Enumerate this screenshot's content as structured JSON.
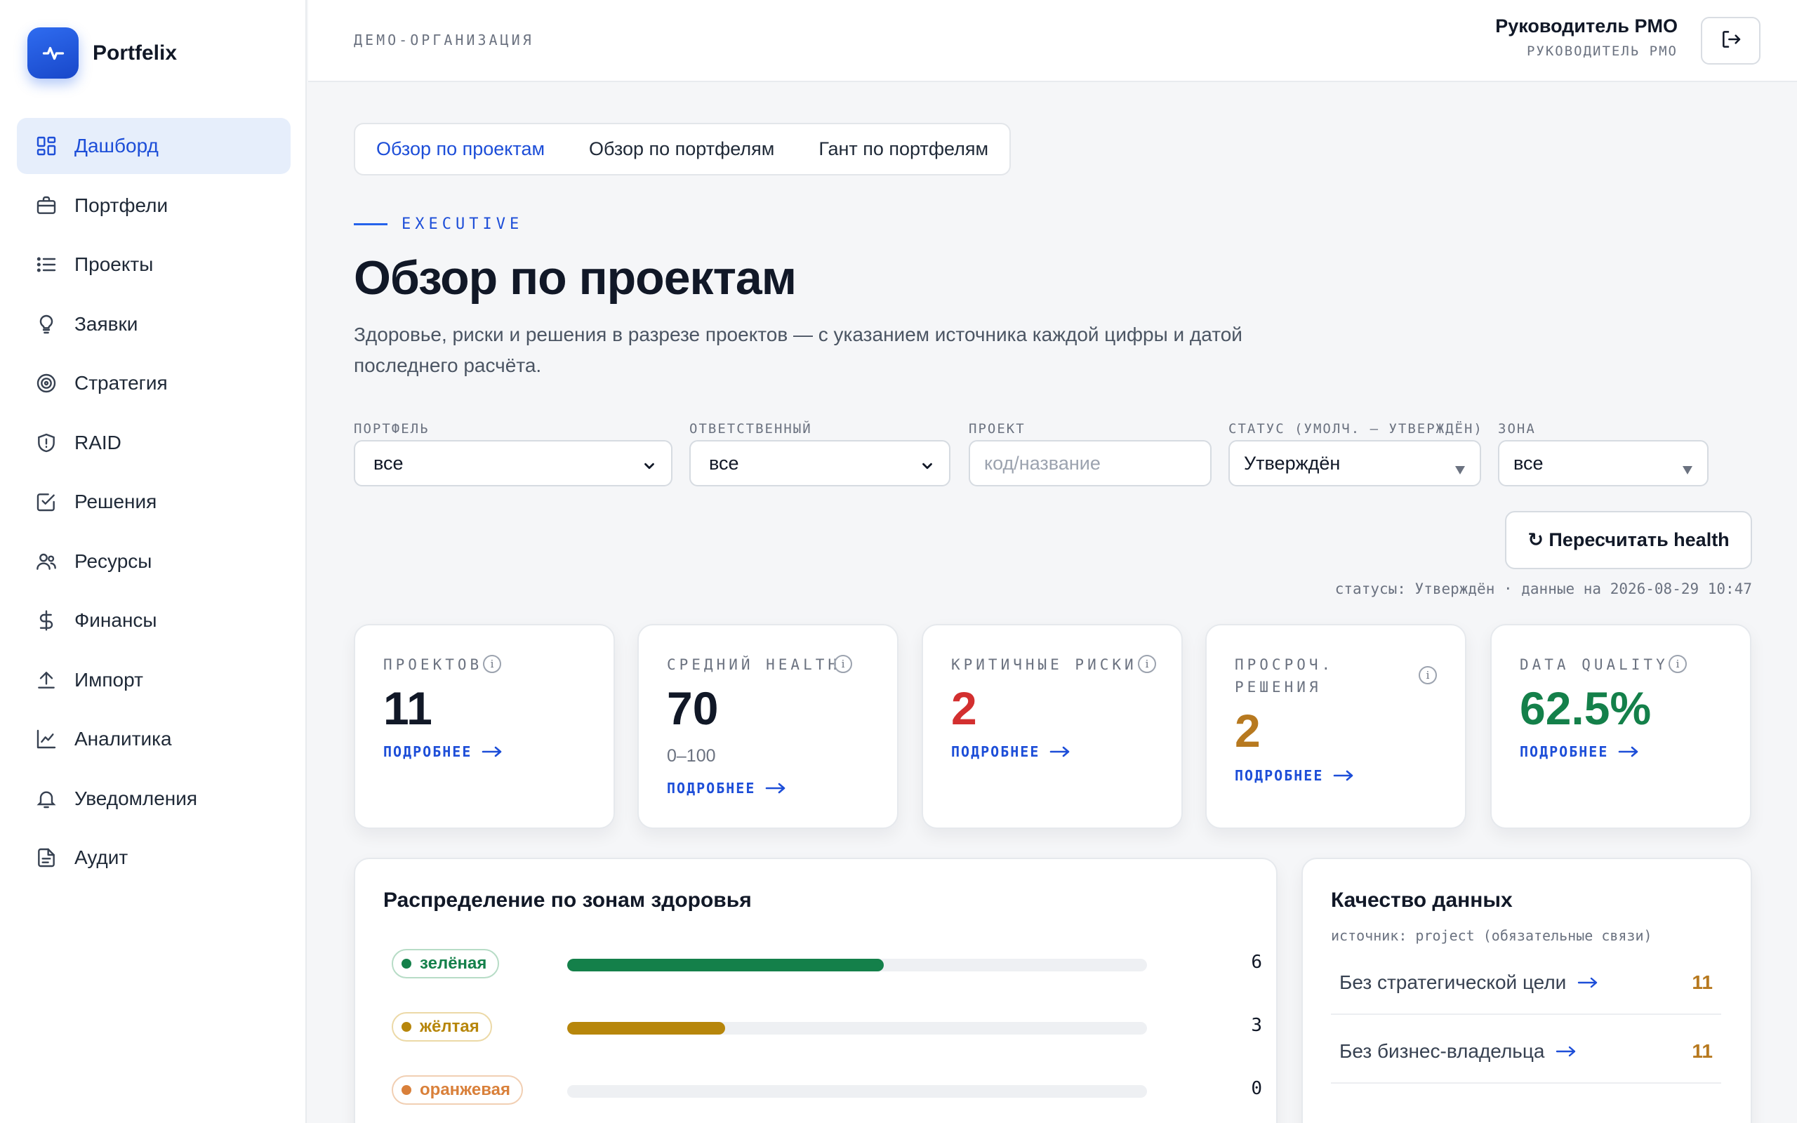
{
  "brand": {
    "name": "Portfelix",
    "icon": "pulse-icon"
  },
  "sidebar": {
    "items": [
      {
        "label": "Дашборд",
        "icon": "dashboard-grid-icon",
        "active": true
      },
      {
        "label": "Портфели",
        "icon": "briefcase-icon"
      },
      {
        "label": "Проекты",
        "icon": "list-icon"
      },
      {
        "label": "Заявки",
        "icon": "lightbulb-icon"
      },
      {
        "label": "Стратегия",
        "icon": "target-icon"
      },
      {
        "label": "RAID",
        "icon": "shield-alert-icon"
      },
      {
        "label": "Решения",
        "icon": "checkbox-icon"
      },
      {
        "label": "Ресурсы",
        "icon": "users-icon"
      },
      {
        "label": "Финансы",
        "icon": "dollar-icon"
      },
      {
        "label": "Импорт",
        "icon": "upload-icon"
      },
      {
        "label": "Аналитика",
        "icon": "line-chart-icon"
      },
      {
        "label": "Уведомления",
        "icon": "bell-icon"
      },
      {
        "label": "Аудит",
        "icon": "document-icon"
      }
    ]
  },
  "header": {
    "org": "ДЕМО-ОРГАНИЗАЦИЯ",
    "user_name": "Руководитель PMO",
    "user_role": "РУКОВОДИТЕЛЬ PMO",
    "logout_icon": "logout-icon"
  },
  "tabs": [
    {
      "label": "Обзор по проектам",
      "active": true
    },
    {
      "label": "Обзор по портфелям"
    },
    {
      "label": "Гант по портфелям"
    }
  ],
  "page": {
    "eyebrow": "EXECUTIVE",
    "title": "Обзор по проектам",
    "subtitle": "Здоровье, риски и решения в разрезе проектов — с указанием источника каждой цифры и датой последнего расчёта."
  },
  "filters": {
    "portfolio": {
      "label": "ПОРТФЕЛЬ",
      "value": "все"
    },
    "owner": {
      "label": "ОТВЕТСТВЕННЫЙ",
      "value": "все"
    },
    "project": {
      "label": "ПРОЕКТ",
      "placeholder": "код/название"
    },
    "status": {
      "label": "СТАТУС (УМОЛЧ. — УТВЕРЖДЁН)",
      "value": "Утверждён"
    },
    "zone": {
      "label": "ЗОНА",
      "value": "все"
    }
  },
  "actions": {
    "recalc": "↻ Пересчитать health"
  },
  "meta": {
    "line": "статусы: Утверждён · данные на 2026-08-29 10:47"
  },
  "kpis": [
    {
      "label": "ПРОЕКТОВ",
      "value": "11",
      "color": "#111827",
      "more": "ПОДРОБНЕЕ"
    },
    {
      "label": "СРЕДНИЙ HEALTH",
      "value": "70",
      "sub": "0–100",
      "color": "#111827",
      "more": "ПОДРОБНЕЕ"
    },
    {
      "label": "КРИТИЧНЫЕ РИСКИ",
      "value": "2",
      "color": "#d32f2f",
      "more": "ПОДРОБНЕЕ"
    },
    {
      "label_line1": "ПРОСРОЧ.",
      "label_line2": "РЕШЕНИЯ",
      "value": "2",
      "color": "#b7791f",
      "more": "ПОДРОБНЕЕ"
    },
    {
      "label": "DATA QUALITY",
      "value": "62.5%",
      "color": "#14804a",
      "more": "ПОДРОБНЕЕ"
    }
  ],
  "zones_panel": {
    "title": "Распределение по зонам здоровья",
    "total": 11,
    "zones": [
      {
        "label": "зелёная",
        "count": 6,
        "color": "#14804a",
        "border": "#b7dcc6"
      },
      {
        "label": "жёлтая",
        "count": 3,
        "color": "#b7860b",
        "border": "#ecd9a7"
      },
      {
        "label": "оранжевая",
        "count": 0,
        "color": "#d9803a",
        "border": "#f1cfb3"
      }
    ]
  },
  "dq_panel": {
    "title": "Качество данных",
    "source": "источник: project (обязательные связи)",
    "rows": [
      {
        "label": "Без стратегической цели",
        "count": "11"
      },
      {
        "label": "Без бизнес-владельца",
        "count": "11"
      }
    ]
  }
}
